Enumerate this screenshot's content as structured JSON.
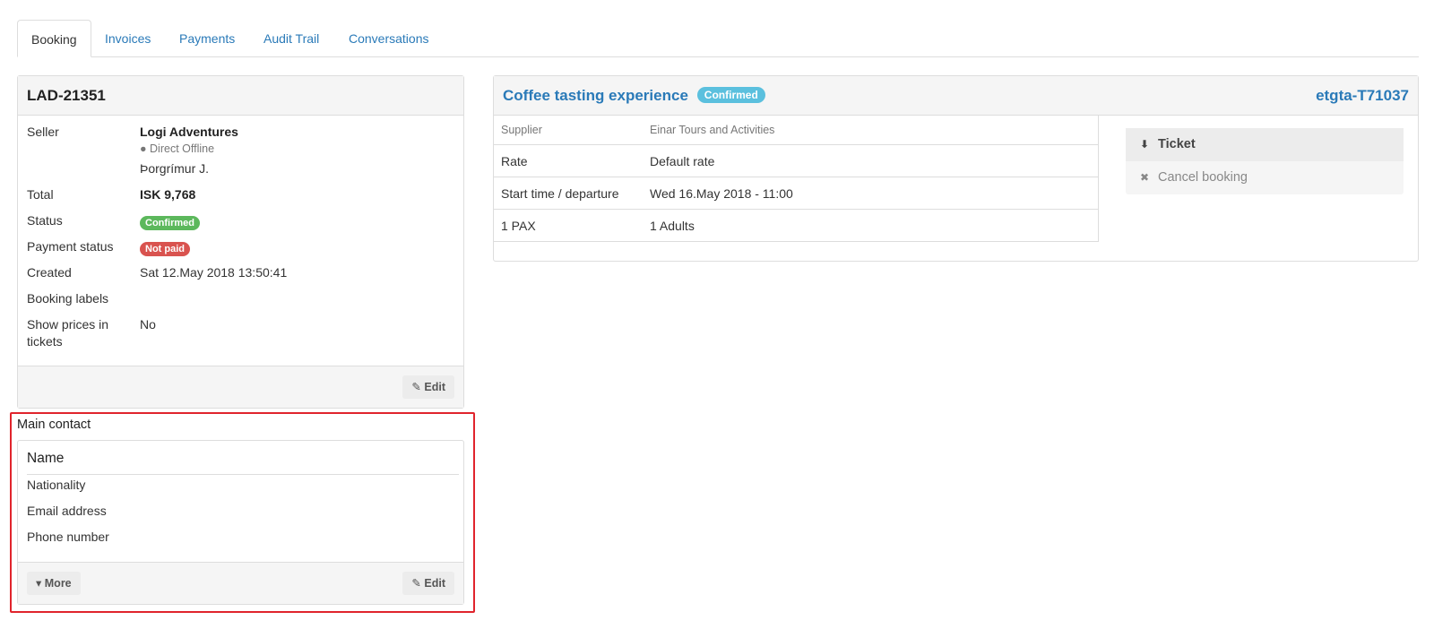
{
  "tabs": [
    "Booking",
    "Invoices",
    "Payments",
    "Audit Trail",
    "Conversations"
  ],
  "booking": {
    "id": "LAD-21351",
    "seller_label": "Seller",
    "seller_name": "Logi Adventures",
    "seller_channel": "Direct Offline",
    "seller_user": "Þorgrímur J.",
    "total_label": "Total",
    "total_value": "ISK 9,768",
    "status_label": "Status",
    "status_value": "Confirmed",
    "payment_status_label": "Payment status",
    "payment_status_value": "Not paid",
    "created_label": "Created",
    "created_value": "Sat 12.May 2018 13:50:41",
    "labels_label": "Booking labels",
    "show_prices_label_1": "Show prices in",
    "show_prices_label_2": "tickets",
    "show_prices_value": "No",
    "edit_label": "Edit"
  },
  "contact": {
    "title": "Main contact",
    "name_label": "Name",
    "nationality_label": "Nationality",
    "email_label": "Email address",
    "phone_label": "Phone number",
    "more_label": "More",
    "edit_label": "Edit"
  },
  "product": {
    "title": "Coffee tasting experience",
    "status": "Confirmed",
    "reference": "etgta-T71037",
    "rows": [
      {
        "label": "Supplier",
        "value": "Einar Tours and Activities"
      },
      {
        "label": "Rate",
        "value": "Default rate"
      },
      {
        "label": "Start time / departure",
        "value": "Wed 16.May 2018 - 11:00"
      },
      {
        "label": "1 PAX",
        "value": "1 Adults"
      }
    ],
    "actions": {
      "ticket": "Ticket",
      "cancel": "Cancel booking"
    }
  },
  "colors": {
    "link": "#2a7ab8",
    "confirmed": "#5cb85c",
    "not_paid": "#d9534f",
    "highlight": "#e0242c"
  },
  "icons": [
    "user-icon",
    "edit-icon",
    "caret-down-icon",
    "download-icon",
    "times-icon"
  ]
}
